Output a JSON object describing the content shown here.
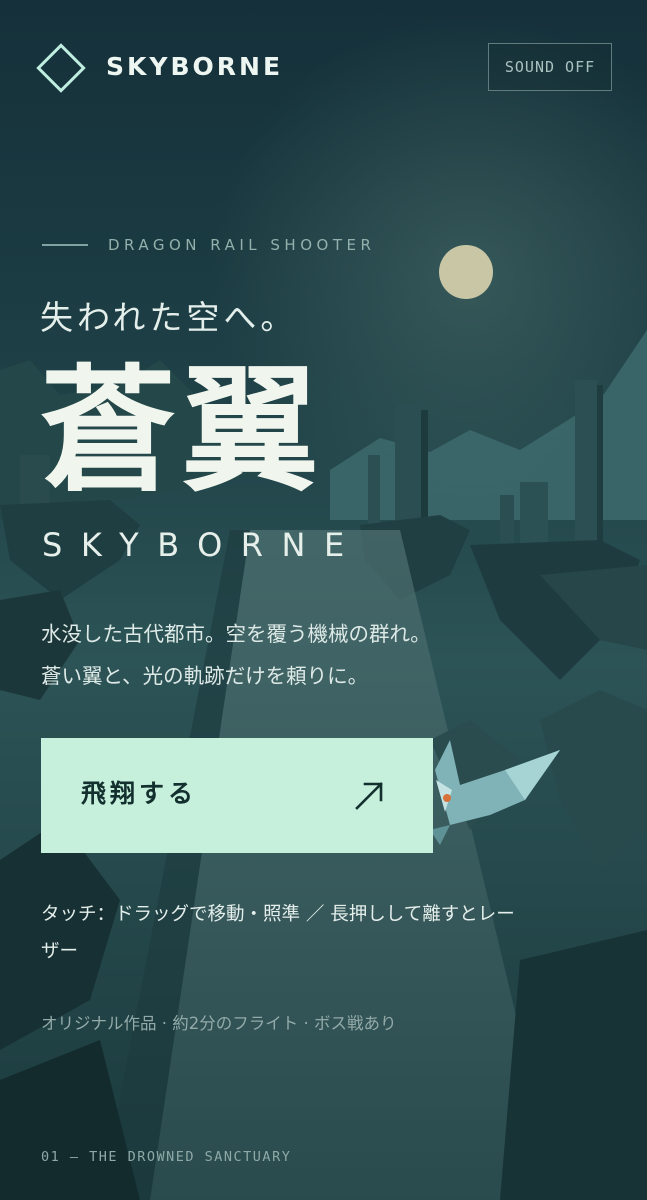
{
  "header": {
    "brand": "SKYBORNE",
    "sound_toggle": "SOUND OFF"
  },
  "hero": {
    "tagline": "DRAGON RAIL SHOOTER",
    "subtitle": "失われた空へ。",
    "title_jp": "蒼翼",
    "title_en": "SKYBORNE",
    "description": [
      "水没した古代都市。空を覆う機械の群れ。",
      "蒼い翼と、光の軌跡だけを頼りに。"
    ]
  },
  "cta": {
    "label": "飛翔する",
    "icon": "arrow-up-right-icon"
  },
  "controls_text": "タッチ：ドラッグで移動・照準 ／ 長押しして離すとレーザー",
  "credits_text": "オリジナル作品 · 約2分のフライト · ボス戦あり",
  "chapter_text": "01 — THE DROWNED SANCTUARY",
  "colors": {
    "background": "#1a3a3e",
    "accent": "#c6f0dc",
    "moon": "#c9c6a6",
    "text": "#dfeee9"
  }
}
